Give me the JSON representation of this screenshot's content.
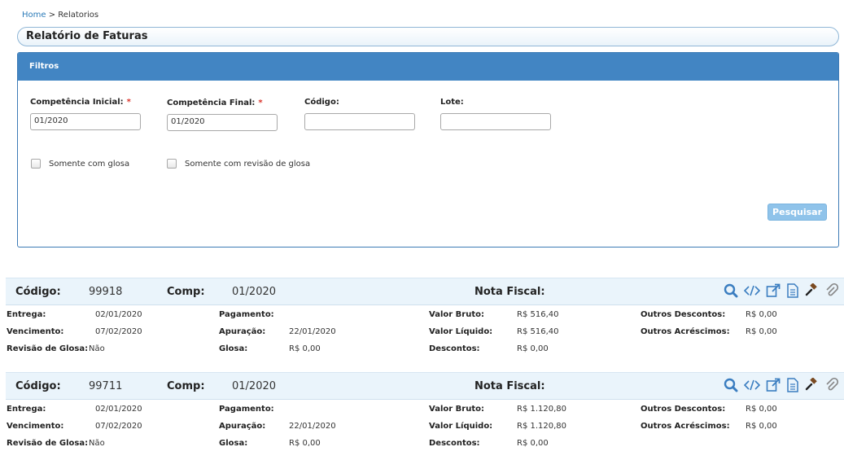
{
  "breadcrumb": {
    "home": "Home",
    "separator": ">",
    "current": "Relatorios"
  },
  "page_title": "Relatório de Faturas",
  "filters": {
    "header": "Filtros",
    "competencia_inicial": {
      "label": "Competência Inicial:",
      "required": "*",
      "value": "01/2020"
    },
    "competencia_final": {
      "label": "Competência Final:",
      "required": "*",
      "value": "01/2020"
    },
    "codigo": {
      "label": "Código:",
      "value": ""
    },
    "lote": {
      "label": "Lote:",
      "value": ""
    },
    "somente_glosa": "Somente com glosa",
    "somente_revisao_glosa": "Somente com revisão de glosa",
    "search_button": "Pesquisar"
  },
  "labels": {
    "codigo": "Código:",
    "comp": "Comp:",
    "nota_fiscal": "Nota Fiscal:",
    "entrega": "Entrega:",
    "vencimento": "Vencimento:",
    "revisao_glosa": "Revisão de Glosa:",
    "pagamento": "Pagamento:",
    "apuracao": "Apuração:",
    "glosa": "Glosa:",
    "valor_bruto": "Valor Bruto:",
    "valor_liquido": "Valor Líquido:",
    "descontos": "Descontos:",
    "outros_descontos": "Outros Descontos:",
    "outros_acrescimos": "Outros Acréscimos:"
  },
  "invoices": [
    {
      "codigo": "99918",
      "comp": "01/2020",
      "nota_fiscal": "",
      "entrega": "02/01/2020",
      "vencimento": "07/02/2020",
      "revisao_glosa": "Não",
      "pagamento": "",
      "apuracao": "22/01/2020",
      "glosa": "R$ 0,00",
      "valor_bruto": "R$ 516,40",
      "valor_liquido": "R$ 516,40",
      "descontos": "R$ 0,00",
      "outros_descontos": "R$ 0,00",
      "outros_acrescimos": "R$ 0,00"
    },
    {
      "codigo": "99711",
      "comp": "01/2020",
      "nota_fiscal": "",
      "entrega": "02/01/2020",
      "vencimento": "07/02/2020",
      "revisao_glosa": "Não",
      "pagamento": "",
      "apuracao": "22/01/2020",
      "glosa": "R$ 0,00",
      "valor_bruto": "R$ 1.120,80",
      "valor_liquido": "R$ 1.120,80",
      "descontos": "R$ 0,00",
      "outros_descontos": "R$ 0,00",
      "outros_acrescimos": "R$ 0,00"
    }
  ],
  "icons": [
    "search-icon",
    "code-icon",
    "external-link-icon",
    "document-icon",
    "gavel-icon",
    "paperclip-icon"
  ],
  "colors": {
    "header_blue": "#4285c3",
    "accent": "#3a7dc0",
    "required": "#d9342b",
    "card_bg": "#eaf4fb"
  }
}
